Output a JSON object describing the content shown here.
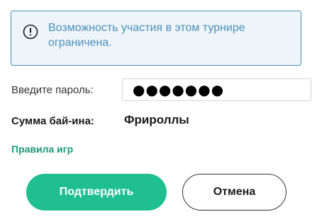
{
  "notice": {
    "icon": "info-circle-icon",
    "text": "Возможность участия в этом турнире ограничена.",
    "color": "#4a8fb8",
    "background": "#eef5fa"
  },
  "password": {
    "label": "Введите пароль:",
    "value_masked": "●●●●●●●"
  },
  "buyin": {
    "label": "Сумма бай-ина:",
    "value": "Фрироллы"
  },
  "rules_link": {
    "label": "Правила игр",
    "color": "#1a9a78"
  },
  "buttons": {
    "confirm_label": "Подтвердить",
    "cancel_label": "Отмена",
    "confirm_color": "#1fbf90"
  }
}
